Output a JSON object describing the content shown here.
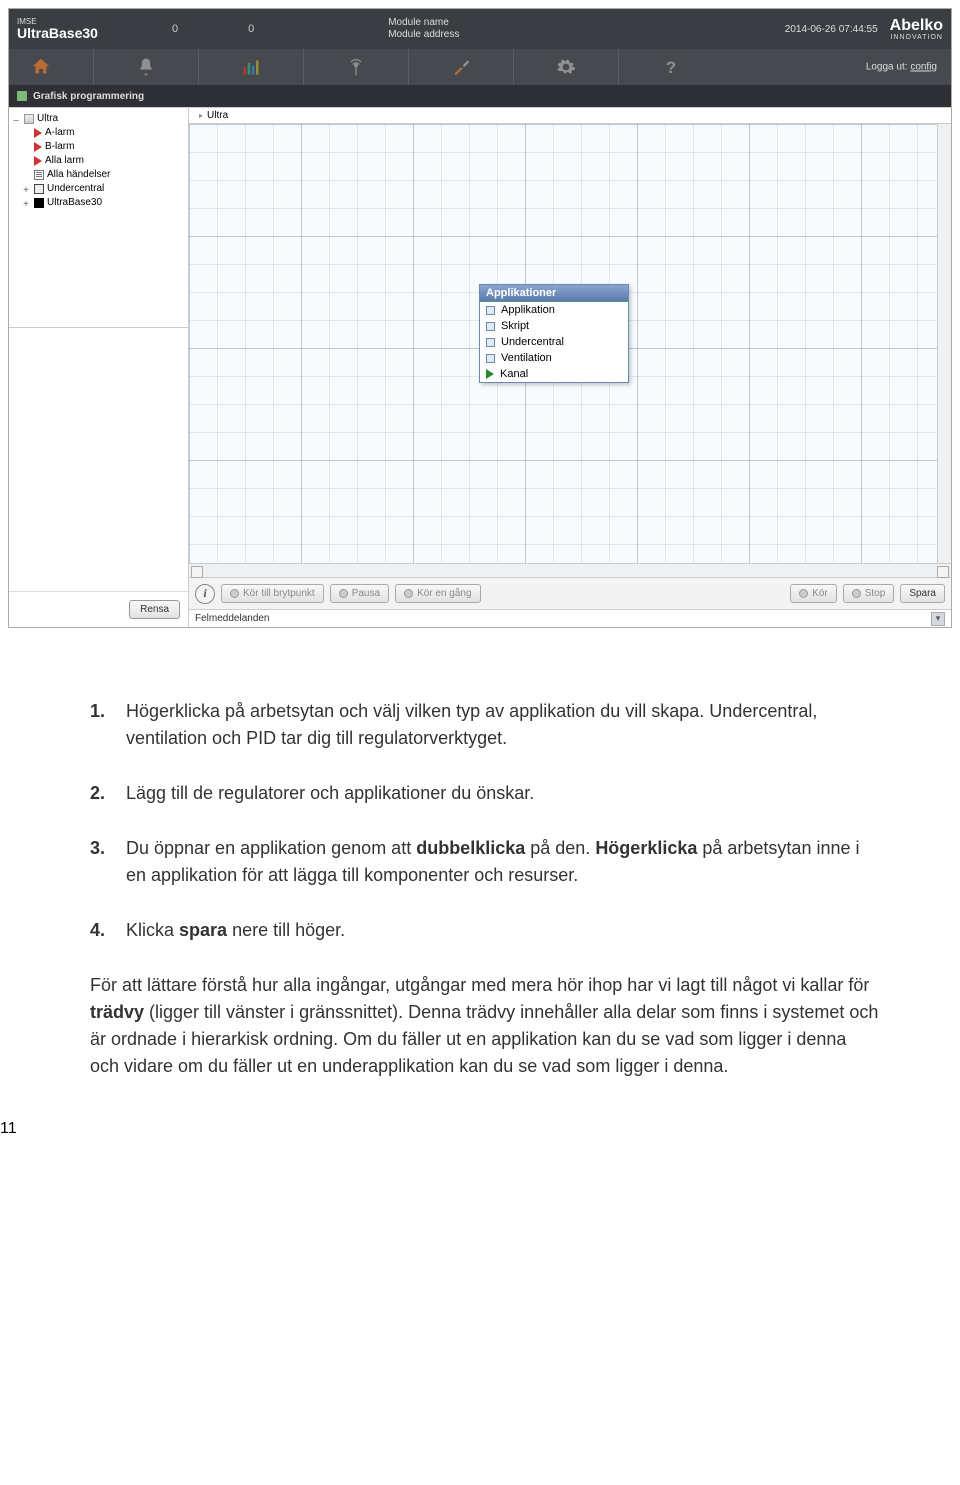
{
  "topbar": {
    "imse": "IMSE",
    "product": "UltraBase30",
    "zeros": [
      "0",
      "0"
    ],
    "module_name_label": "Module name",
    "module_addr_label": "Module address",
    "timestamp": "2014-06-26 07:44:55",
    "brand": "Abelko",
    "brand_sub": "INNOVATION"
  },
  "navrow": {
    "logout_label": "Logga ut:",
    "logout_user": "config"
  },
  "breadcrumb": {
    "label": "Grafisk programmering"
  },
  "tree": {
    "items": [
      {
        "indent": 1,
        "icon": "gray",
        "tw": "–",
        "label": "Ultra"
      },
      {
        "indent": 2,
        "icon": "redflag",
        "tw": "",
        "label": "A-larm"
      },
      {
        "indent": 2,
        "icon": "redflag",
        "tw": "",
        "label": "B-larm"
      },
      {
        "indent": 2,
        "icon": "redflag",
        "tw": "",
        "label": "Alla larm"
      },
      {
        "indent": 2,
        "icon": "list",
        "tw": "",
        "label": "Alla händelser"
      },
      {
        "indent": 2,
        "icon": "box",
        "tw": "+",
        "label": "Undercentral"
      },
      {
        "indent": 2,
        "icon": "black",
        "tw": "+",
        "label": "UltraBase30"
      }
    ]
  },
  "canvas_head": "Ultra",
  "context_menu": {
    "header": "Applikationer",
    "items": [
      {
        "kind": "sq",
        "label": "Applikation"
      },
      {
        "kind": "sq",
        "label": "Skript"
      },
      {
        "kind": "sq",
        "label": "Undercentral"
      },
      {
        "kind": "sq",
        "label": "Ventilation"
      },
      {
        "kind": "tri",
        "label": "Kanal"
      }
    ]
  },
  "toolbar": {
    "run_to_bp": "Kör till brytpunkt",
    "pause": "Pausa",
    "run_once": "Kör en gång",
    "run": "Kör",
    "stop": "Stop",
    "save": "Spara"
  },
  "sidebar_bot_btn": "Rensa",
  "errbar": "Felmeddelanden",
  "doc": {
    "step1": "Högerklicka på arbetsytan och välj vilken typ av applikation du vill skapa. Undercentral, ventilation och PID tar dig till regulatorverktyget.",
    "step2": "Lägg till de regulatorer och applikationer du önskar.",
    "step3_a": "Du öppnar en applikation genom att ",
    "step3_b": "dubbelklicka",
    "step3_c": " på den. ",
    "step3_d": "Högerklicka",
    "step3_e": " på arbetsytan inne i en applikation för att lägga till komponenter och resurser.",
    "step4_a": "Klicka ",
    "step4_b": "spara",
    "step4_c": " nere till höger.",
    "para_a": "För att lättare förstå hur alla ingångar, utgångar med mera hör ihop har vi lagt till något vi kallar för ",
    "para_b": "trädvy",
    "para_c": " (ligger till vänster i gränssnittet). Denna trädvy innehåller alla delar som finns i systemet och är ordnade i hierarkisk ordning. Om du fäller ut en applikation kan du se vad som ligger i denna och vidare om du fäller ut en underapplikation kan du se vad som ligger i denna.",
    "page": "11"
  }
}
